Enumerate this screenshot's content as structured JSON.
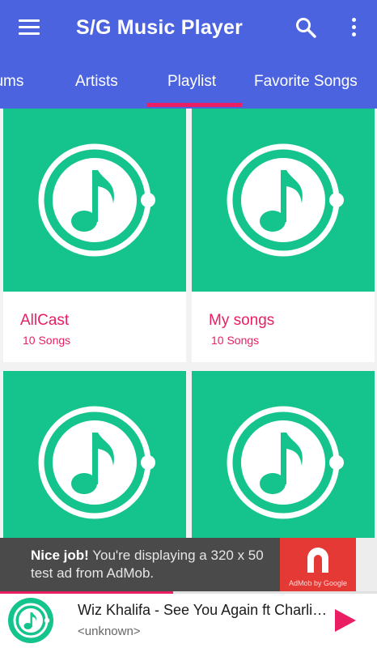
{
  "app": {
    "title": "S/G Music Player",
    "accent_color": "#e91e63",
    "bar_color": "#4c63e0",
    "tile_color": "#14c48c"
  },
  "toolbar": {
    "menu_icon": "hamburger-menu-icon",
    "search_icon": "search-icon",
    "more_icon": "more-vert-icon"
  },
  "tabs": [
    {
      "label": "Albums",
      "selected": false
    },
    {
      "label": "Artists",
      "selected": false
    },
    {
      "label": "Playlist",
      "selected": true
    },
    {
      "label": "Favorite Songs",
      "selected": false
    }
  ],
  "playlists": [
    {
      "name": "AllCast",
      "count": "10 Songs",
      "icon": "music-note-icon"
    },
    {
      "name": "My songs",
      "count": "10 Songs",
      "icon": "music-note-icon"
    },
    {
      "name": "",
      "count": "",
      "icon": "music-note-icon"
    },
    {
      "name": "",
      "count": "",
      "icon": "music-note-icon"
    }
  ],
  "ad": {
    "headline": "Nice job!",
    "body": " You're displaying a 320 x 50 test ad from AdMob.",
    "badge_caption": "AdMob by Google",
    "badge_icon": "admob-logo-icon"
  },
  "now_playing": {
    "title": "Wiz Khalifa - See You Again ft Charlie Puth",
    "artist": "<unknown>",
    "progress": 0.46,
    "play_icon": "play-icon"
  }
}
